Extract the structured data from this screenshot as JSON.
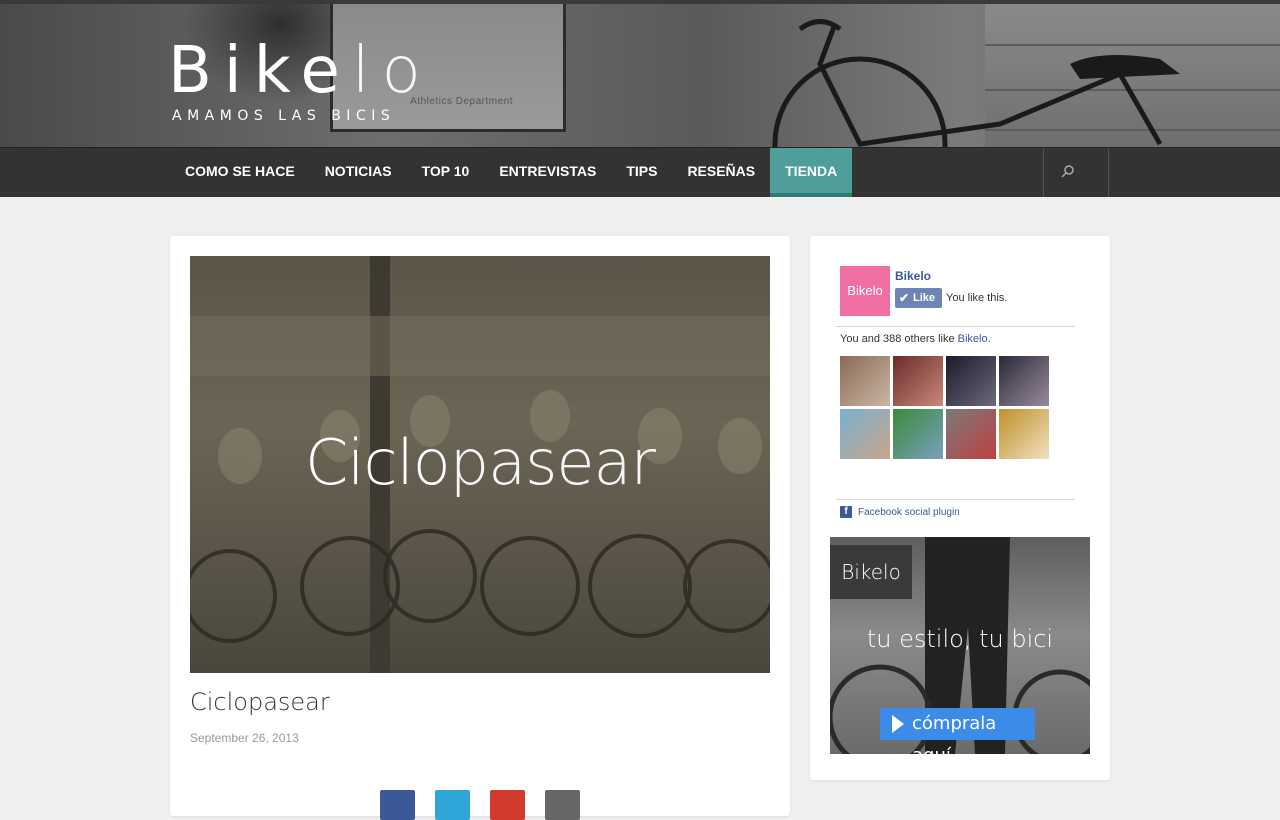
{
  "site": {
    "logo_bold": "Bike",
    "logo_light": "lo",
    "tagline": "AMAMOS LAS BICIS",
    "header_sign": "Athletics Department"
  },
  "nav": {
    "items": [
      {
        "label": "COMO SE HACE",
        "active": false
      },
      {
        "label": "NOTICIAS",
        "active": false
      },
      {
        "label": "TOP 10",
        "active": false
      },
      {
        "label": "ENTREVISTAS",
        "active": false
      },
      {
        "label": "TIPS",
        "active": false
      },
      {
        "label": "RESEÑAS",
        "active": false
      },
      {
        "label": "TIENDA",
        "active": true
      }
    ],
    "search_icon": "search-icon",
    "active_color": "#4f9e9a"
  },
  "post": {
    "hero_title_bold": "Ciclo",
    "hero_title_light": "pasear",
    "title": "Ciclopasear",
    "date": "September 26, 2013",
    "share_buttons": [
      {
        "icon": "facebook-icon",
        "color": "#3b5998"
      },
      {
        "icon": "twitter-icon",
        "color": "#2fa6d8"
      },
      {
        "icon": "google-plus-icon",
        "color": "#d23a2e"
      },
      {
        "icon": "email-icon",
        "color": "#666666"
      }
    ]
  },
  "facebook_widget": {
    "page_logo_bold": "Bike",
    "page_logo_light": "lo",
    "page_name": "Bikelo",
    "like_label": "Like",
    "you_like": "You like this.",
    "count_text": "You and 388 others like ",
    "count_link": "Bikelo",
    "count_end": ".",
    "plugin_label": "Facebook social plugin"
  },
  "ad": {
    "logo_bold": "Bike",
    "logo_light": "lo",
    "slogan": "tu estilo, tu bici",
    "button_label": "cómprala aquí",
    "button_color": "#3d8be8"
  }
}
